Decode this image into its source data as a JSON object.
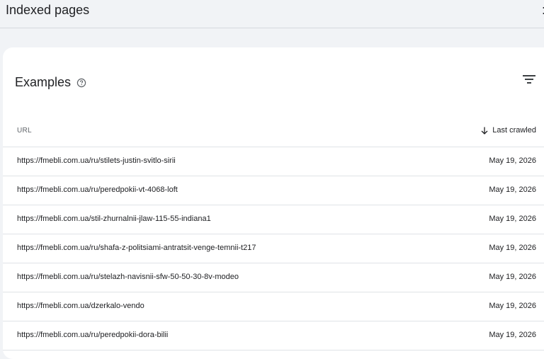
{
  "header": {
    "title": "Indexed pages",
    "more_glyph": ":"
  },
  "card": {
    "title": "Examples",
    "help_icon": "help-circle-icon",
    "filter_icon": "filter-icon"
  },
  "table": {
    "columns": {
      "url": "URL",
      "last_crawled": "Last crawled",
      "sort_icon": "arrow-down-icon"
    },
    "rows": [
      {
        "url": "https://fmebli.com.ua/ru/stilets-justin-svitlo-sirii",
        "date": "May 19, 2026"
      },
      {
        "url": "https://fmebli.com.ua/ru/peredpokii-vt-4068-loft",
        "date": "May 19, 2026"
      },
      {
        "url": "https://fmebli.com.ua/stil-zhurnalnii-jlaw-115-55-indiana1",
        "date": "May 19, 2026"
      },
      {
        "url": "https://fmebli.com.ua/ru/shafa-z-politsiami-antratsit-venge-temnii-t217",
        "date": "May 19, 2026"
      },
      {
        "url": "https://fmebli.com.ua/ru/stelazh-navisnii-sfw-50-50-30-8v-modeo",
        "date": "May 19, 2026"
      },
      {
        "url": "https://fmebli.com.ua/dzerkalo-vendo",
        "date": "May 19, 2026"
      },
      {
        "url": "https://fmebli.com.ua/ru/peredpokii-dora-bilii",
        "date": "May 19, 2026"
      }
    ]
  },
  "colors": {
    "background": "#f1f3f6",
    "card": "#ffffff",
    "text": "#202124",
    "muted": "#5f6368",
    "divider": "#e0e3e7"
  }
}
